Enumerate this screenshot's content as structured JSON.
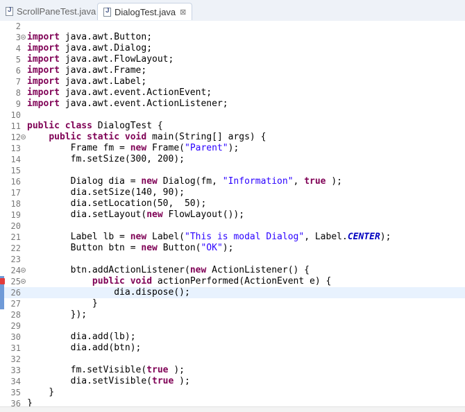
{
  "tabs": [
    {
      "label": "ScrollPaneTest.java",
      "active": false
    },
    {
      "label": "DialogTest.java",
      "active": true,
      "close": "⊠"
    }
  ],
  "lines": [
    {
      "n": "2",
      "tokens": []
    },
    {
      "n": "3",
      "fold": true,
      "tokens": [
        [
          "kw",
          "import"
        ],
        [
          "",
          "java.awt.Button;"
        ]
      ]
    },
    {
      "n": "4",
      "tokens": [
        [
          "kw",
          "import"
        ],
        [
          "",
          "java.awt.Dialog;"
        ]
      ]
    },
    {
      "n": "5",
      "tokens": [
        [
          "kw",
          "import"
        ],
        [
          "",
          "java.awt.FlowLayout;"
        ]
      ]
    },
    {
      "n": "6",
      "tokens": [
        [
          "kw",
          "import"
        ],
        [
          "",
          "java.awt.Frame;"
        ]
      ]
    },
    {
      "n": "7",
      "tokens": [
        [
          "kw",
          "import"
        ],
        [
          "",
          "java.awt.Label;"
        ]
      ]
    },
    {
      "n": "8",
      "tokens": [
        [
          "kw",
          "import"
        ],
        [
          "",
          "java.awt.event.ActionEvent;"
        ]
      ]
    },
    {
      "n": "9",
      "tokens": [
        [
          "kw",
          "import"
        ],
        [
          "",
          "java.awt.event.ActionListener;"
        ]
      ]
    },
    {
      "n": "10",
      "tokens": []
    },
    {
      "n": "11",
      "tokens": [
        [
          "kw",
          "public"
        ],
        [
          "kw",
          "class"
        ],
        [
          "",
          "DialogTest {"
        ]
      ]
    },
    {
      "n": "12",
      "fold": true,
      "tokens": [
        [
          "",
          "    "
        ],
        [
          "kw",
          "public"
        ],
        [
          "kw",
          "static"
        ],
        [
          "kw",
          "void"
        ],
        [
          "",
          "main(String[] args) {"
        ]
      ]
    },
    {
      "n": "13",
      "tokens": [
        [
          "",
          "        Frame fm = "
        ],
        [
          "kw",
          "new"
        ],
        [
          "",
          "Frame("
        ],
        [
          "str",
          "\"Parent\""
        ],
        [
          "",
          ");"
        ]
      ]
    },
    {
      "n": "14",
      "tokens": [
        [
          "",
          "        fm.setSize(300, 200);"
        ]
      ]
    },
    {
      "n": "15",
      "tokens": []
    },
    {
      "n": "16",
      "tokens": [
        [
          "",
          "        Dialog dia = "
        ],
        [
          "kw",
          "new"
        ],
        [
          "",
          "Dialog(fm, "
        ],
        [
          "str",
          "\"Information\""
        ],
        [
          "",
          ", "
        ],
        [
          "kw",
          "true"
        ],
        [
          "",
          ");"
        ]
      ]
    },
    {
      "n": "17",
      "tokens": [
        [
          "",
          "        dia.setSize(140, 90);"
        ]
      ]
    },
    {
      "n": "18",
      "tokens": [
        [
          "",
          "        dia.setLocation(50,  50);"
        ]
      ]
    },
    {
      "n": "19",
      "tokens": [
        [
          "",
          "        dia.setLayout("
        ],
        [
          "kw",
          "new"
        ],
        [
          "",
          "FlowLayout());"
        ]
      ]
    },
    {
      "n": "20",
      "tokens": []
    },
    {
      "n": "21",
      "tokens": [
        [
          "",
          "        Label lb = "
        ],
        [
          "kw",
          "new"
        ],
        [
          "",
          "Label("
        ],
        [
          "str",
          "\"This is modal Dialog\""
        ],
        [
          "",
          ", Label."
        ],
        [
          "field",
          "CENTER"
        ],
        [
          "",
          ");"
        ]
      ]
    },
    {
      "n": "22",
      "tokens": [
        [
          "",
          "        Button btn = "
        ],
        [
          "kw",
          "new"
        ],
        [
          "",
          "Button("
        ],
        [
          "str",
          "\"OK\""
        ],
        [
          "",
          ");"
        ]
      ]
    },
    {
      "n": "23",
      "tokens": []
    },
    {
      "n": "24",
      "fold": true,
      "tokens": [
        [
          "",
          "        btn.addActionListener("
        ],
        [
          "kw",
          "new"
        ],
        [
          "",
          "ActionListener() {"
        ]
      ]
    },
    {
      "n": "25",
      "fold": true,
      "error": true,
      "marker": true,
      "tokens": [
        [
          "",
          "            "
        ],
        [
          "kw",
          "public"
        ],
        [
          "kw",
          "void"
        ],
        [
          "",
          "actionPerformed(ActionEvent e) {"
        ]
      ]
    },
    {
      "n": "26",
      "current": true,
      "marker": true,
      "tokens": [
        [
          "",
          "                dia.dispose();"
        ]
      ]
    },
    {
      "n": "27",
      "marker": true,
      "tokens": [
        [
          "",
          "            }"
        ]
      ]
    },
    {
      "n": "28",
      "tokens": [
        [
          "",
          "        });"
        ]
      ]
    },
    {
      "n": "29",
      "tokens": []
    },
    {
      "n": "30",
      "tokens": [
        [
          "",
          "        dia.add(lb);"
        ]
      ]
    },
    {
      "n": "31",
      "tokens": [
        [
          "",
          "        dia.add(btn);"
        ]
      ]
    },
    {
      "n": "32",
      "tokens": []
    },
    {
      "n": "33",
      "tokens": [
        [
          "",
          "        fm.setVisible("
        ],
        [
          "kw",
          "true"
        ],
        [
          "",
          ");"
        ]
      ]
    },
    {
      "n": "34",
      "tokens": [
        [
          "",
          "        dia.setVisible("
        ],
        [
          "kw",
          "true"
        ],
        [
          "",
          ");"
        ]
      ]
    },
    {
      "n": "35",
      "tokens": [
        [
          "",
          "    }"
        ]
      ]
    },
    {
      "n": "36",
      "tokens": [
        [
          "",
          "}"
        ]
      ]
    }
  ]
}
